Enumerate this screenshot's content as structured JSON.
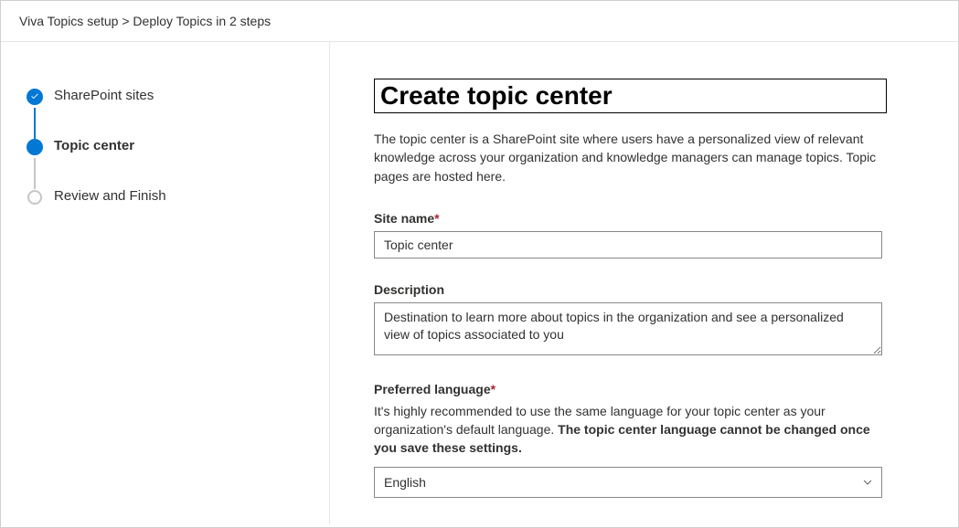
{
  "breadcrumb": {
    "level1": "Viva Topics setup",
    "separator": ">",
    "level2": "Deploy Topics in 2 steps"
  },
  "steps": [
    {
      "label": "SharePoint sites",
      "state": "completed"
    },
    {
      "label": "Topic center",
      "state": "current"
    },
    {
      "label": "Review and Finish",
      "state": "pending"
    }
  ],
  "page": {
    "title": "Create topic center",
    "description": "The topic center is a SharePoint site where users have a personalized view of relevant knowledge across your organization and knowledge managers can manage topics. Topic pages are hosted here."
  },
  "form": {
    "site_name": {
      "label": "Site name",
      "required": "*",
      "value": "Topic center"
    },
    "description": {
      "label": "Description",
      "value": "Destination to learn more about topics in the organization and see a personalized view of topics associated to you"
    },
    "language": {
      "label": "Preferred language",
      "required": "*",
      "help_prefix": "It's highly recommended to use the same language for your topic center as your organization's default language. ",
      "help_bold": "The topic center language cannot be changed once you save these settings.",
      "value": "English"
    }
  }
}
